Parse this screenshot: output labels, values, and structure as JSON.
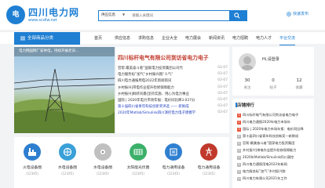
{
  "logo": {
    "mark": "电",
    "title": "四川电力网",
    "url": "www.scdlw.net"
  },
  "search": {
    "category": "供应信息",
    "placeholder": "请输入关键词"
  },
  "header": {
    "quick_publish": "快速发布"
  },
  "nav": {
    "all_label": "全部商品分类",
    "items": [
      "首页",
      "供应信息",
      "求购信息",
      "企业大全",
      "电力展会",
      "新闻资讯",
      "电力招聘",
      "电力人才",
      "平台交流"
    ],
    "active_index": 8
  },
  "banner": {
    "caption": "电力网国网广安供电，持续开展老旧..."
  },
  "news": {
    "headline": "四川标杆电气有限公司到访省电力电子",
    "items": [
      {
        "title": "官帮:最美奋斗者”国家电力投资集团公司代",
        "date": "03-07"
      },
      {
        "title": "电力服务标”加气”乡村振兴跑”人气”",
        "date": "03-07"
      },
      {
        "title": "四川电力通报用电2022年新闻简讯",
        "date": "03-07"
      },
      {
        "title": "乡村振兴|带电作业提升检修保障能力",
        "date": "03-07"
      },
      {
        "title": "乡村振兴|鲜虾风暴|坚持实施、用心为电力事业",
        "date": "03-07"
      },
      {
        "title": "国际 | 2020年电力市场年报：电价同比降3.037分",
        "date": "03-07"
      },
      {
        "title": "第十届四川省青年科技创新奖评选 —— 新鲜成",
        "date": "03-07",
        "highlight": true
      },
      {
        "title": "2020年Matlab/Simulink四川演控电力电子建模学",
        "date": "03-07",
        "highlight": true
      }
    ]
  },
  "user": {
    "welcome": "Hi,请登录",
    "stats": [
      {
        "value": "30",
        "label": "关注"
      },
      {
        "value": "0",
        "label": "帖子"
      },
      {
        "value": "12",
        "label": "收藏"
      }
    ]
  },
  "ranking": {
    "title": "店铺排行",
    "items": [
      "四川标杆电气有限公司到访省电力电子",
      "四川电力通报2020年电力市场年",
      "国际 | 2020年电力市场年报：电价同比降",
      "第十届四川省青年科技创新奖—新鲜成",
      "官帮:最美奋斗者”国家电力投资集团",
      "乡村振兴|带电作业提升检修保障能力",
      "2020年Matlab/Simulink四川演控",
      "四川电力通报用电2022年新闻",
      "电力服务标”加气”乡村振兴跑",
      "四川电力有限公司2021年工作"
    ]
  },
  "categories": [
    {
      "icon": "power-plant-icon",
      "label": "火电设备圈",
      "count": "(12345)",
      "color": "#2f7fd0"
    },
    {
      "icon": "water-turbine-icon",
      "label": "水电设备圈",
      "count": "(12345)",
      "color": "#3aa0d8"
    },
    {
      "icon": "wind-turbine-icon",
      "label": "水电设备圈",
      "count": "(12345)",
      "color": "#c0c0c0"
    },
    {
      "icon": "solar-panel-icon",
      "label": "太阳能光伏圈",
      "count": "(12345)",
      "color": "#3bb06a"
    },
    {
      "icon": "transformer-icon",
      "label": "电力通用设备",
      "count": "(12345)",
      "color": "#2f7fd0"
    },
    {
      "icon": "tower-icon",
      "label": "电力通用设备",
      "count": "(12345)",
      "color": "#c0392b"
    }
  ],
  "colors": {
    "accent": "#1e7fd3",
    "headline": "#c0392b",
    "highlight": "#1e3fbf"
  }
}
